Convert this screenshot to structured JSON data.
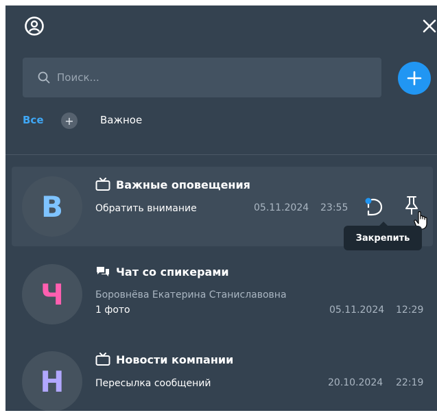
{
  "search": {
    "placeholder": "Поиск..."
  },
  "tabs": {
    "all": "Все",
    "add": "+",
    "important": "Важное"
  },
  "chats": [
    {
      "avatar_letter": "В",
      "avatar_color": "#7ec3ff",
      "icon": "tv-icon",
      "title": "Важные оповещения",
      "sender": "",
      "subtitle": "Обратить внимание",
      "date": "05.11.2024",
      "time": "23:55"
    },
    {
      "avatar_letter": "Ч",
      "avatar_color": "#ff5fb0",
      "icon": "chat-bubbles-icon",
      "title": "Чат со спикерами",
      "sender": "Боровнёва Екатерина Станиславовна",
      "subtitle": "1 фото",
      "date": "05.11.2024",
      "time": "12:29"
    },
    {
      "avatar_letter": "Н",
      "avatar_color": "#b1a7ff",
      "icon": "tv-icon",
      "title": "Новости компании",
      "sender": "",
      "subtitle": "Пересылка сообщений",
      "date": "20.10.2024",
      "time": "22:19"
    }
  ],
  "tooltip": {
    "pin": "Закрепить"
  },
  "colors": {
    "background": "#344250",
    "accent": "#2196f3",
    "active_row": "#3e4c5a"
  }
}
